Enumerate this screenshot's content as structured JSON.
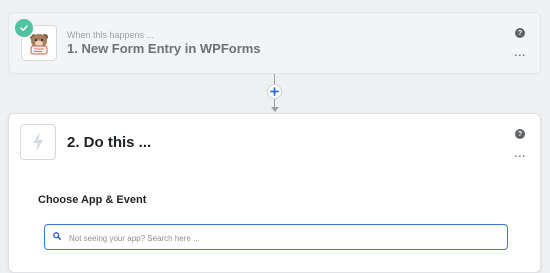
{
  "trigger": {
    "subtitle": "When this happens ...",
    "title": "1. New Form Entry in WPForms",
    "app_icon": "wpforms-bear-icon",
    "status_icon": "check-icon",
    "help": "?",
    "more": "..."
  },
  "connector": {
    "add_icon": "plus-icon"
  },
  "action": {
    "title": "2. Do this ...",
    "app_icon": "lightning-bolt-icon",
    "help": "?",
    "more": "...",
    "section_label": "Choose App & Event",
    "search": {
      "placeholder": "Not seeing your app? Search here ...",
      "value": ""
    }
  },
  "colors": {
    "accent": "#3a7bd5",
    "success": "#4fc3a1",
    "background": "#eef0f1"
  }
}
